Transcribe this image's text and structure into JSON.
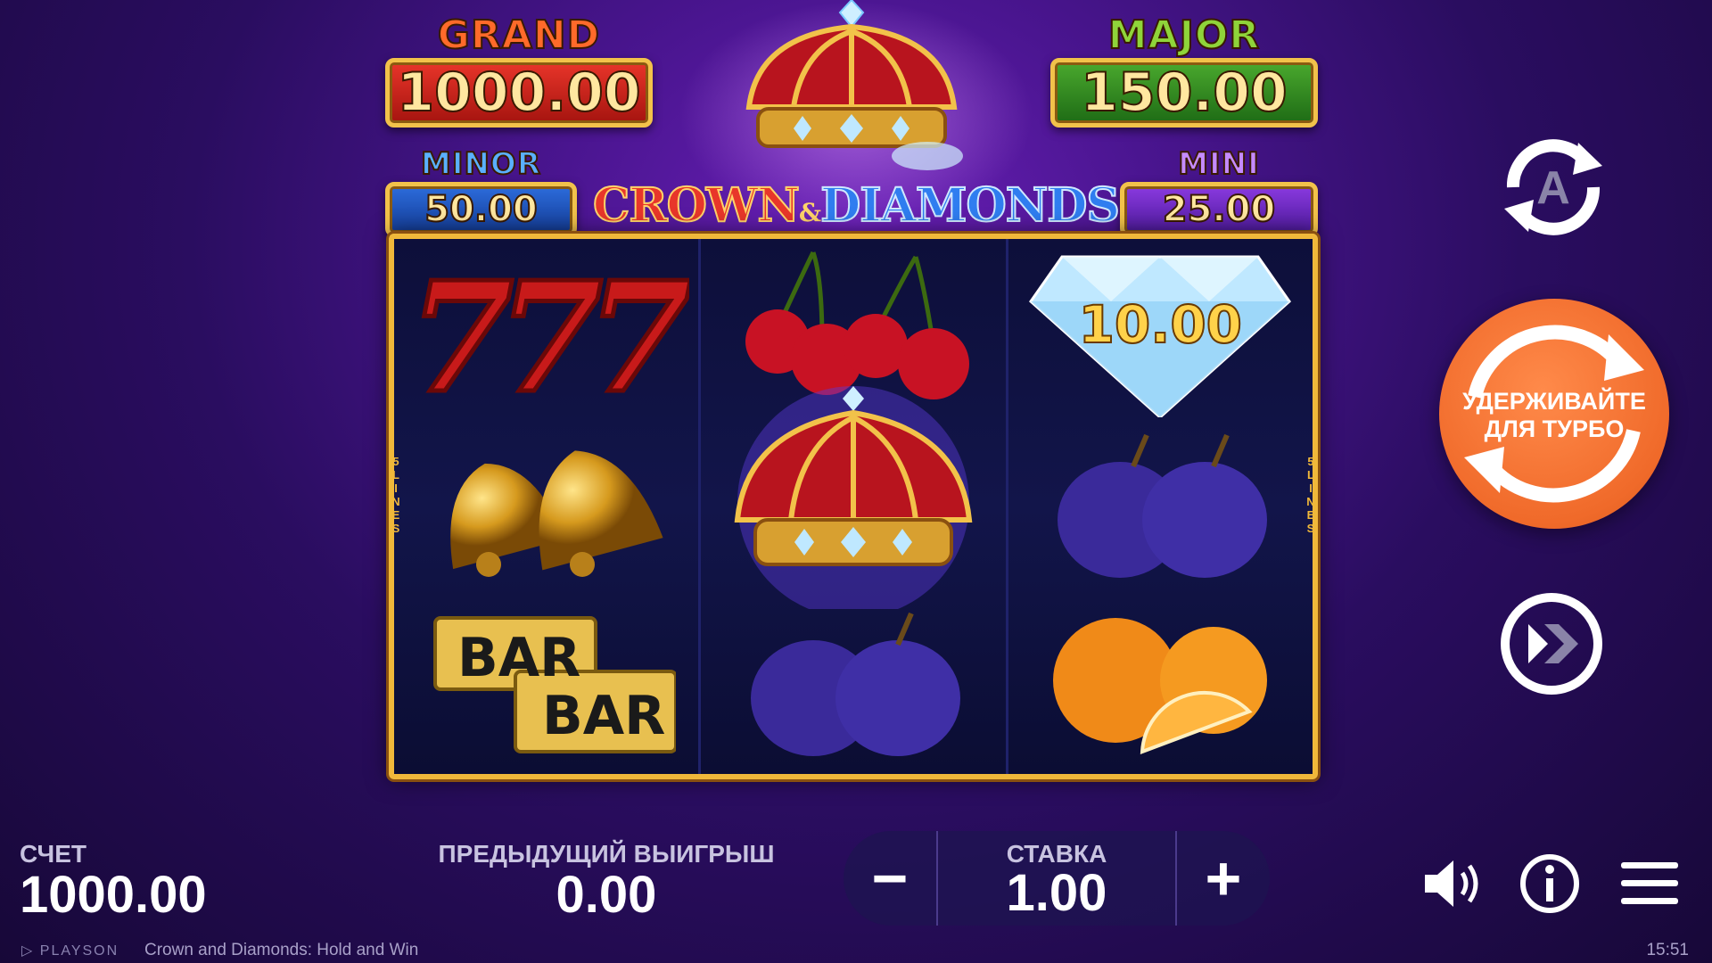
{
  "jackpots": {
    "grand": {
      "label": "GRAND",
      "value": "1000.00"
    },
    "major": {
      "label": "MAJOR",
      "value": "150.00"
    },
    "minor": {
      "label": "MINOR",
      "value": "50.00"
    },
    "mini": {
      "label": "MINI",
      "value": "25.00"
    }
  },
  "logo": {
    "part1": "CROWN",
    "amp": "&",
    "part2": "DIAMONDS"
  },
  "paylines_label": [
    "5",
    "L",
    "I",
    "N",
    "E",
    "S"
  ],
  "reels": [
    [
      "seven-777",
      "golden-bells",
      "bar-bar"
    ],
    [
      "cherries",
      "crown",
      "plums"
    ],
    [
      "diamond",
      "plums",
      "oranges"
    ]
  ],
  "diamond_value": "10.00",
  "controls": {
    "autoplay_icon": "autoplay-icon",
    "autoplay_letter": "A",
    "spin_label": "УДЕРЖИВАЙТЕ ДЛЯ ТУРБО",
    "spin_line1": "УДЕРЖИВАЙТЕ",
    "spin_line2": "ДЛЯ ТУРБО",
    "turbo_icon": "fast-forward-icon"
  },
  "bottom": {
    "balance_label": "СЧЕТ",
    "balance_value": "1000.00",
    "lastwin_label": "ПРЕДЫДУЩИЙ ВЫИГРЫШ",
    "lastwin_value": "0.00",
    "bet_label": "СТАВКА",
    "bet_value": "1.00",
    "minus": "−",
    "plus": "+"
  },
  "footer": {
    "brand": "PLAYSON",
    "game_title": "Crown and Diamonds: Hold and Win",
    "clock": "15:51"
  },
  "colors": {
    "spin_button": "#f06a2a",
    "reel_frame": "#f0b83a",
    "background": "#4a1590"
  }
}
